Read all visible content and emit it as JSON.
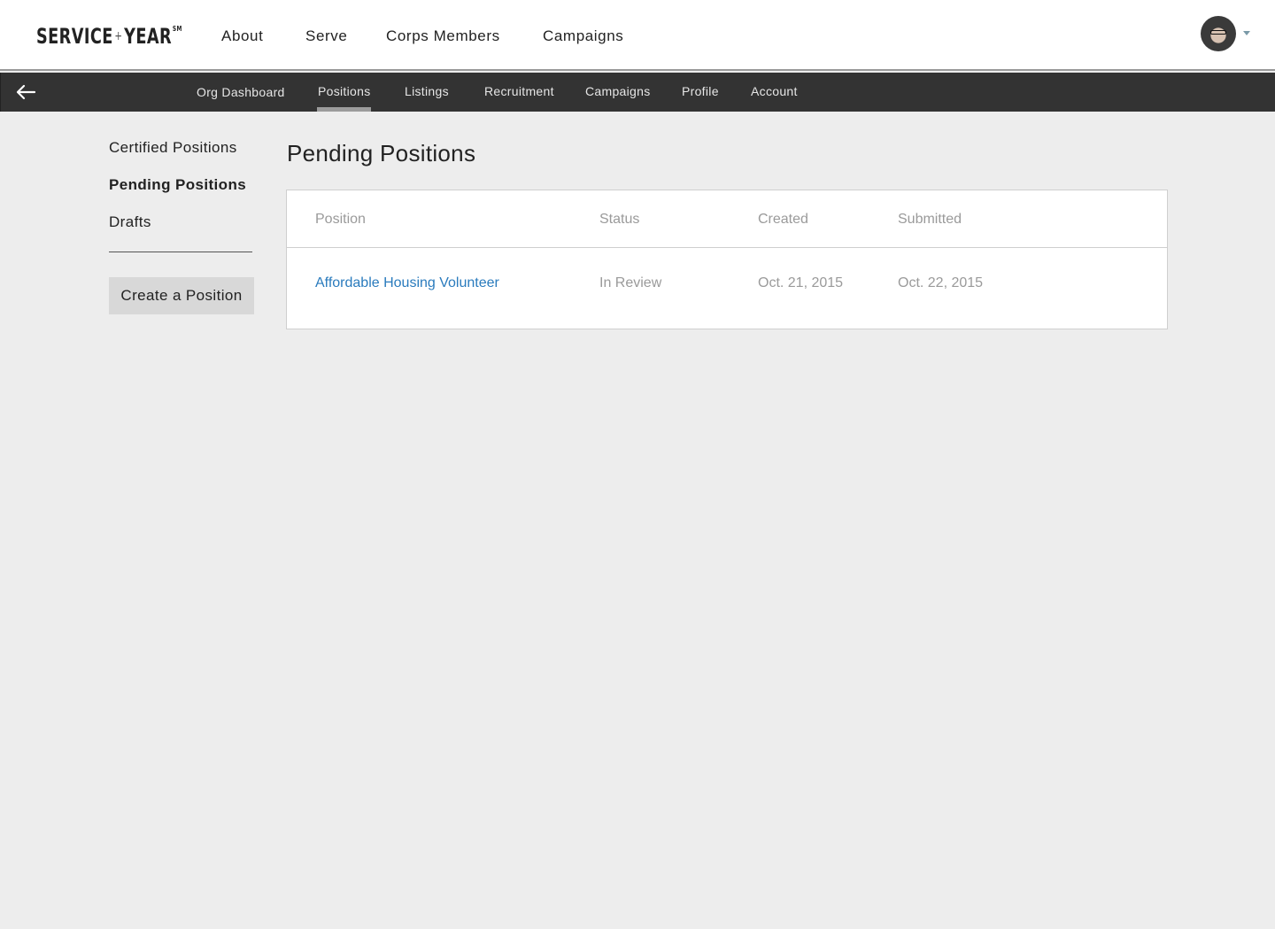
{
  "header": {
    "logo_left": "SERVICE",
    "logo_plus": "+",
    "logo_right": "YEAR",
    "logo_sm": "SM",
    "nav": [
      "About",
      "Serve",
      "Corps Members",
      "Campaigns"
    ],
    "avatar_icon": "user-avatar",
    "caret_color": "#7a9aa8"
  },
  "subnav": {
    "back_icon": "arrow-left-icon",
    "items": [
      "Org Dashboard",
      "Positions",
      "Listings",
      "Recruitment",
      "Campaigns",
      "Profile",
      "Account"
    ],
    "active": "Positions"
  },
  "sidebar": {
    "items": [
      "Certified Positions",
      "Pending Positions",
      "Drafts"
    ],
    "active": "Pending Positions",
    "create_button": "Create a Position"
  },
  "main": {
    "title": "Pending Positions",
    "table": {
      "columns": [
        "Position",
        "Status",
        "Created",
        "Submitted"
      ],
      "rows": [
        [
          "Affordable Housing Volunteer",
          "In Review",
          "Oct. 21, 2015",
          "Oct. 22, 2015"
        ]
      ]
    }
  },
  "colors": {
    "link": "#2a7bbd",
    "subbar": "#333333",
    "page_bg": "#ededed"
  }
}
